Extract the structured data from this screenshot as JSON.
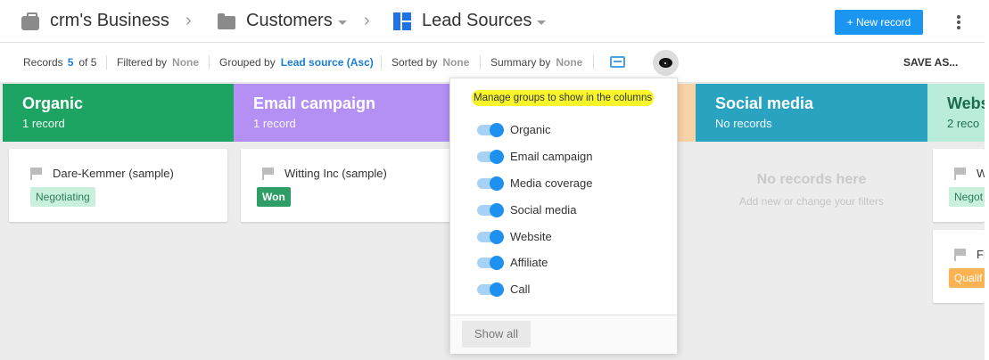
{
  "header": {
    "breadcrumb": [
      {
        "label": "crm's Business",
        "icon": "briefcase-icon"
      },
      {
        "label": "Customers",
        "icon": "folder-icon"
      },
      {
        "label": "Lead Sources",
        "icon": "view-grid-icon"
      }
    ],
    "separator": "›",
    "new_record_label": "+ New record"
  },
  "filterbar": {
    "records_label": "Records",
    "records_count": "5",
    "records_total": "of 5",
    "filtered_label": "Filtered by",
    "filtered_value": "None",
    "grouped_label": "Grouped by",
    "grouped_value": "Lead source (Asc)",
    "sorted_label": "Sorted by",
    "sorted_value": "None",
    "summary_label": "Summary by",
    "summary_value": "None",
    "save_as": "SAVE AS..."
  },
  "columns": [
    {
      "title": "Organic",
      "count": "1 record",
      "color": "#1da462"
    },
    {
      "title": "Email campaign",
      "count": "1 record",
      "color": "#b490f5"
    },
    {
      "title": "",
      "count": "",
      "color": "#f9d2a8"
    },
    {
      "title": "Social media",
      "count": "No records",
      "color": "#2aa3c1"
    },
    {
      "title": "Webs",
      "count": "2 reco",
      "color": "#b9ecd9"
    }
  ],
  "cards": [
    {
      "name": "Dare-Kemmer (sample)",
      "tag": "Negotiating"
    },
    {
      "name": "Witting Inc (sample)",
      "tag": "Won"
    },
    {
      "name": "W",
      "tag": "Negot"
    },
    {
      "name": "Fr",
      "tag": "Qualif"
    }
  ],
  "empty_state": {
    "title": "No records here",
    "subtitle": "Add new or change your filters"
  },
  "popup": {
    "hint": "Manage groups to show in the columns",
    "groups": [
      "Organic",
      "Email campaign",
      "Media coverage",
      "Social media",
      "Website",
      "Affiliate",
      "Call"
    ],
    "show_all": "Show all"
  },
  "colors": {
    "accent": "#1a95f0",
    "tag_negotiating_bg": "#c8f0dc",
    "tag_negotiating_fg": "#2e7d58",
    "tag_won_bg": "#2f9e66",
    "tag_qualified_bg": "#fbb252",
    "highlight": "#f8f62a"
  }
}
